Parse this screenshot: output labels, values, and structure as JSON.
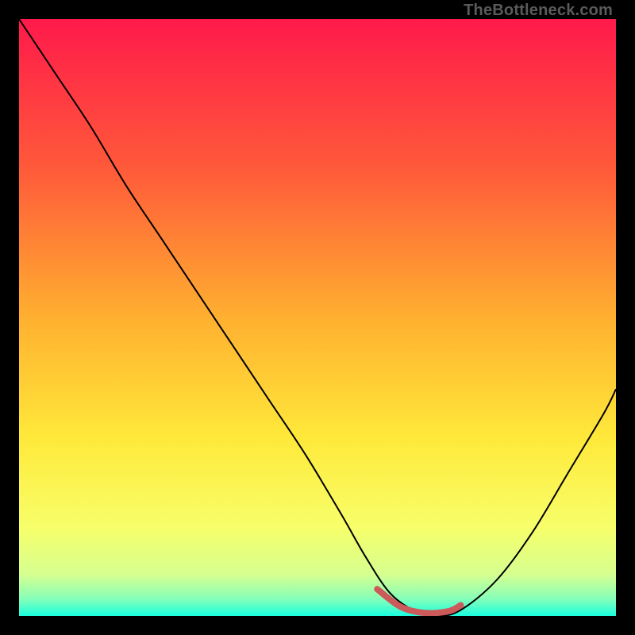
{
  "watermark": {
    "text": "TheBottleneck.com"
  },
  "chart_data": {
    "type": "line",
    "title": "",
    "xlabel": "",
    "ylabel": "",
    "xlim": [
      0,
      100
    ],
    "ylim": [
      0,
      100
    ],
    "grid": false,
    "legend": false,
    "background": {
      "type": "vertical-gradient",
      "stops": [
        {
          "pos": 0.0,
          "color": "#ff1a4b"
        },
        {
          "pos": 0.25,
          "color": "#ff5a3a"
        },
        {
          "pos": 0.5,
          "color": "#ffb030"
        },
        {
          "pos": 0.7,
          "color": "#ffe93a"
        },
        {
          "pos": 0.85,
          "color": "#f8ff6a"
        },
        {
          "pos": 0.93,
          "color": "#d7ff90"
        },
        {
          "pos": 0.97,
          "color": "#8affb8"
        },
        {
          "pos": 1.0,
          "color": "#1bffe0"
        }
      ]
    },
    "series": [
      {
        "name": "bottleneck-curve",
        "color": "#000000",
        "width": 2,
        "x": [
          0,
          6,
          12,
          18,
          24,
          30,
          36,
          42,
          48,
          54,
          58,
          62,
          66,
          70,
          74,
          80,
          86,
          92,
          98,
          100
        ],
        "y": [
          100,
          91,
          82,
          72,
          63,
          54,
          45,
          36,
          27,
          17,
          10,
          4,
          1,
          0,
          1,
          6,
          14,
          24,
          34,
          38
        ]
      },
      {
        "name": "optimal-range-marker",
        "color": "#cc5a5a",
        "width": 8,
        "linecap": "round",
        "x": [
          60,
          64,
          68,
          72,
          74
        ],
        "y": [
          4.5,
          1.5,
          0.5,
          0.8,
          1.8
        ]
      }
    ]
  }
}
